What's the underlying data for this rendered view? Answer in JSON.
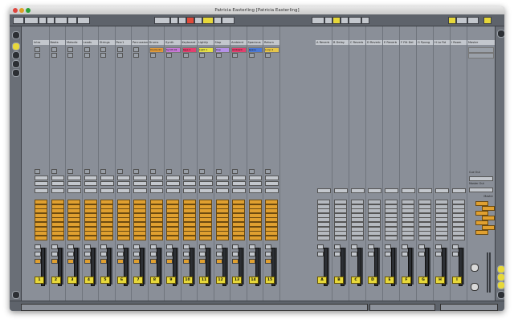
{
  "window": {
    "title": "Patricia Easterling  [Patricia Easterling]"
  },
  "tracks": [
    {
      "name": "Intro",
      "clip": "",
      "clip_color": "",
      "num": "1"
    },
    {
      "name": "Beats",
      "clip": "",
      "clip_color": "",
      "num": "2"
    },
    {
      "name": "Melodic",
      "clip": "",
      "clip_color": "",
      "num": "3"
    },
    {
      "name": "Leads",
      "clip": "",
      "clip_color": "",
      "num": "4"
    },
    {
      "name": "Strings",
      "clip": "",
      "clip_color": "",
      "num": "5"
    },
    {
      "name": "Perc1",
      "clip": "",
      "clip_color": "",
      "num": "6"
    },
    {
      "name": "Percussion",
      "clip": "",
      "clip_color": "",
      "num": "7"
    },
    {
      "name": "Drums",
      "clip": "Drums 01",
      "clip_color": "#e09a3a",
      "num": "8"
    },
    {
      "name": "Synth",
      "clip": "Synth 02",
      "clip_color": "#c779d6",
      "num": "9"
    },
    {
      "name": "Keyboard",
      "clip": "Keys 1",
      "clip_color": "#e43f6f",
      "num": "10"
    },
    {
      "name": "Lightly",
      "clip": "Light 1",
      "clip_color": "#e6e045",
      "num": "11"
    },
    {
      "name": "Slap",
      "clip": "Slap",
      "clip_color": "#b592e8",
      "num": "12"
    },
    {
      "name": "Ambient",
      "clip": "Ambient",
      "clip_color": "#e43f6f",
      "num": "13"
    },
    {
      "name": "Spacious",
      "clip": "Space",
      "clip_color": "#4a78d6",
      "num": "14"
    },
    {
      "name": "Return",
      "clip": "Loop 4",
      "clip_color": "#e6c64a",
      "num": "15"
    }
  ],
  "returns": [
    {
      "name": "A Reverb",
      "letter": "A"
    },
    {
      "name": "B Delay",
      "letter": "B"
    },
    {
      "name": "C Reverb",
      "letter": "C"
    },
    {
      "name": "D Reverb",
      "letter": "D"
    },
    {
      "name": "E Reverb",
      "letter": "E"
    },
    {
      "name": "F Filt Del",
      "letter": "F"
    },
    {
      "name": "G Ppong",
      "letter": "G"
    },
    {
      "name": "H Lo Fid",
      "letter": "H"
    },
    {
      "name": "I Room",
      "letter": "I"
    }
  ],
  "master": {
    "name": "Master",
    "cue_out": "Cue Out",
    "master_out": "Master Out",
    "panel_label": "Master"
  },
  "colors": {
    "accent_yellow": "#e7d83a",
    "send_orange": "#e0a030",
    "bg": "#8a8f98"
  }
}
